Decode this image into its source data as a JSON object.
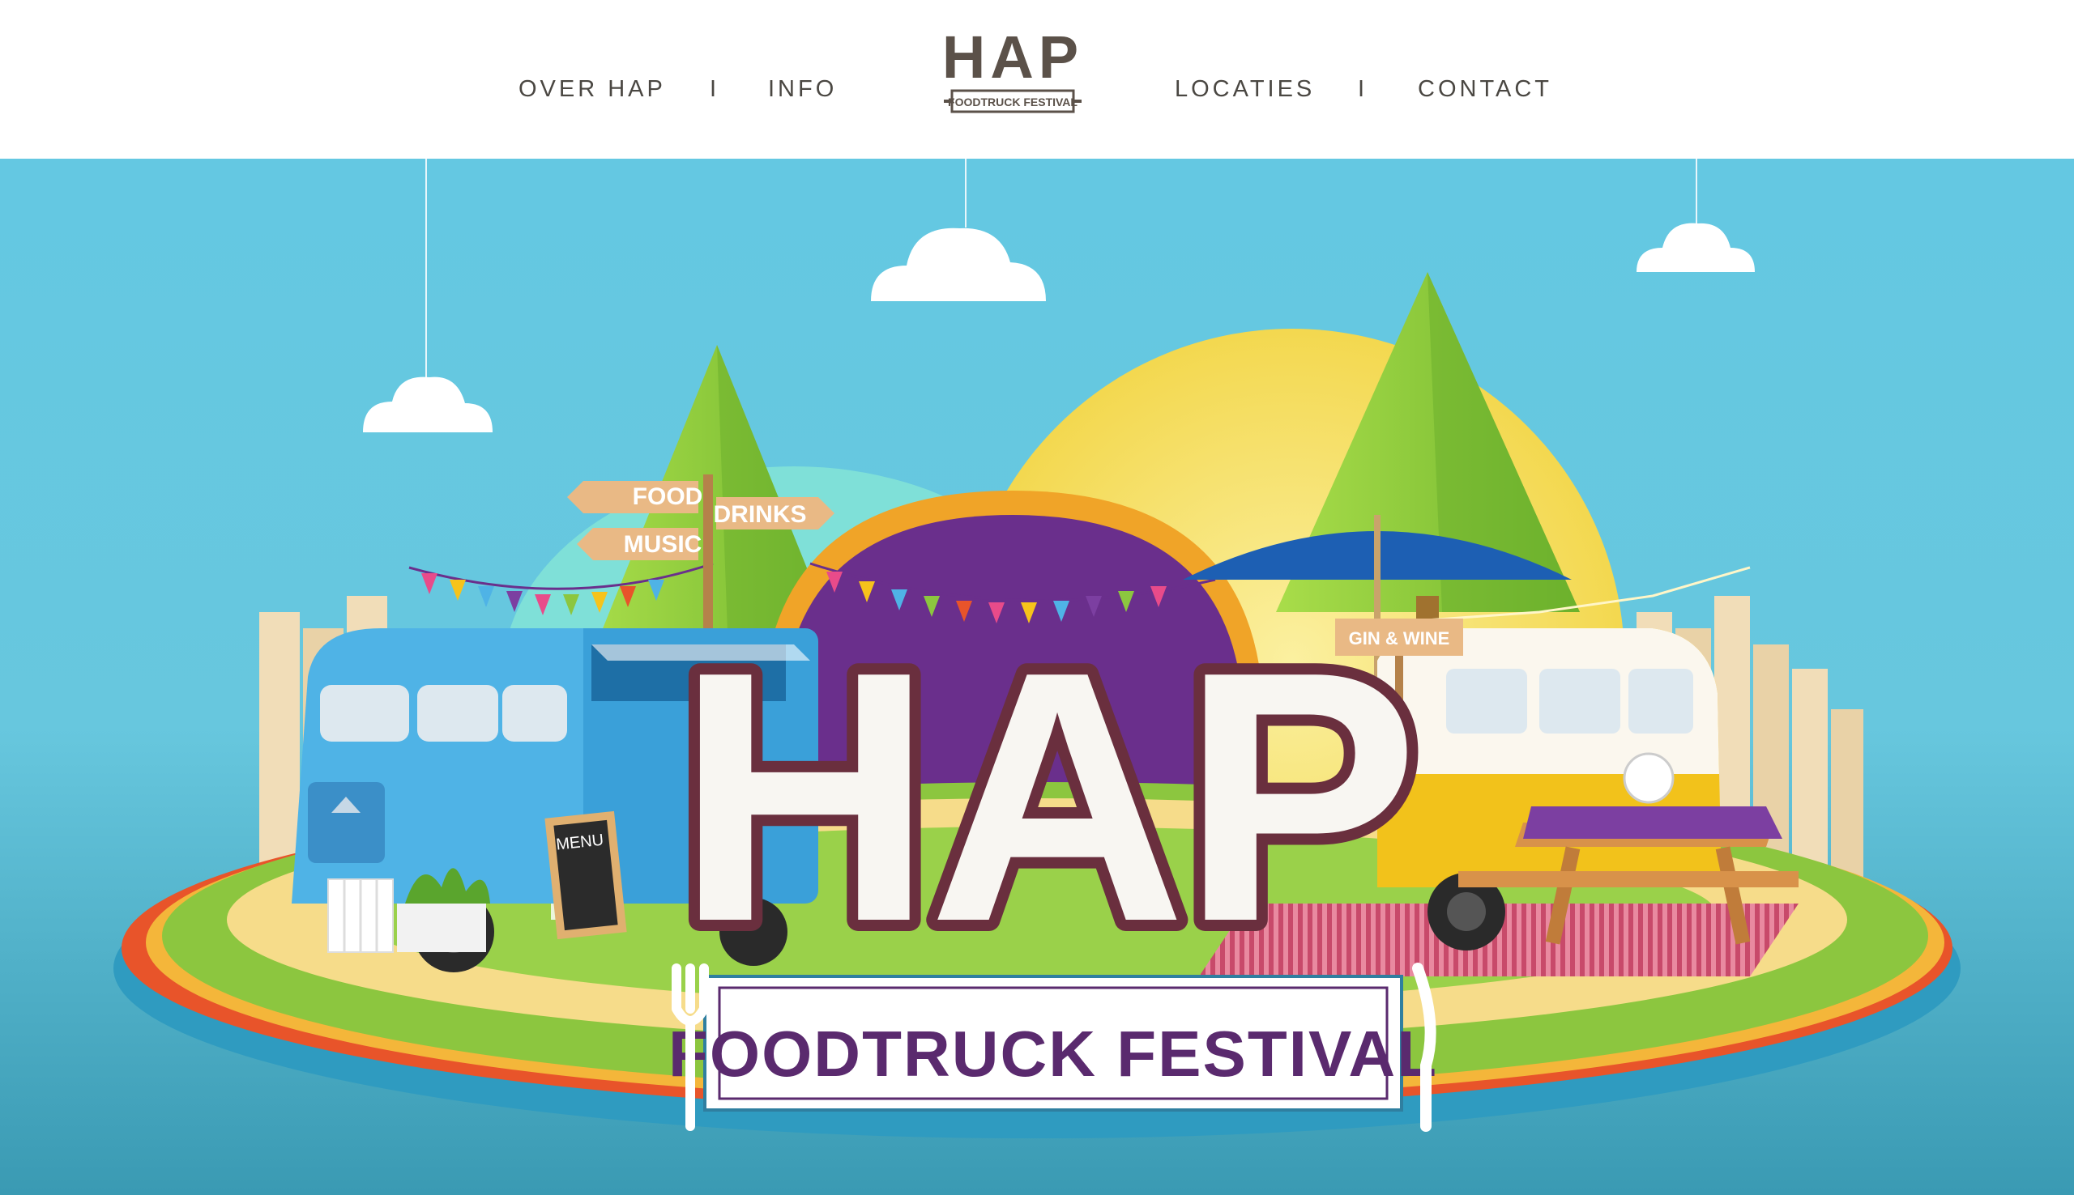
{
  "nav": {
    "left": [
      "OVER HAP",
      "INFO"
    ],
    "right": [
      "LOCATIES",
      "CONTACT"
    ],
    "separator": "I"
  },
  "logo": {
    "title": "HAP",
    "subtitle": "FOODTRUCK FESTIVAL"
  },
  "hero": {
    "signs": [
      "FOOD",
      "MUSIC",
      "DRINKS",
      "GIN & WINE"
    ],
    "menu_board": "MENU",
    "letters": "HAP",
    "banner": "FOODTRUCK FESTIVAL"
  },
  "colors": {
    "sky": "#5cc6df",
    "sun": "#f6e36a",
    "purple": "#6a2f8c",
    "grass": "#8cc63f",
    "blue_truck": "#4fb3e6",
    "yellow_van": "#f2c21b",
    "nav_text": "#4a4742",
    "banner_text": "#5a2a6e"
  }
}
